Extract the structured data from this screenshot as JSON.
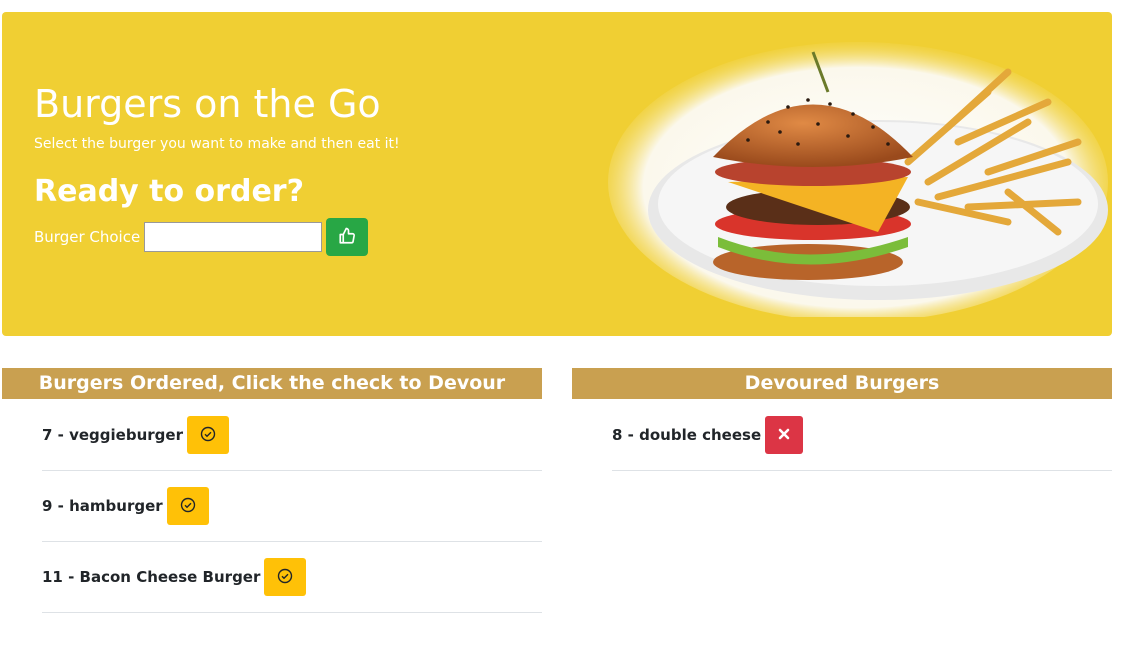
{
  "hero": {
    "title": "Burgers on the Go",
    "subtitle": "Select the burger you want to make and then eat it!",
    "ready_heading": "Ready to order?",
    "choice_label": "Burger Choice",
    "choice_value": "",
    "submit_icon": "thumbs-up-icon",
    "image": "burger-and-fries-photo",
    "background_color": "#f0cf33",
    "submit_color": "#28a745"
  },
  "ordered": {
    "heading": "Burgers Ordered, Click the check to Devour",
    "action_icon": "check-circle-icon",
    "action_color": "#ffc107",
    "items": [
      {
        "label": "7 - veggieburger"
      },
      {
        "label": "9 - hamburger"
      },
      {
        "label": "11 - Bacon Cheese Burger"
      }
    ]
  },
  "devoured": {
    "heading": "Devoured Burgers",
    "action_icon": "close-icon",
    "action_color": "#dc3545",
    "items": [
      {
        "label": "8 - double cheese"
      }
    ]
  },
  "header_color": "#c9a050"
}
